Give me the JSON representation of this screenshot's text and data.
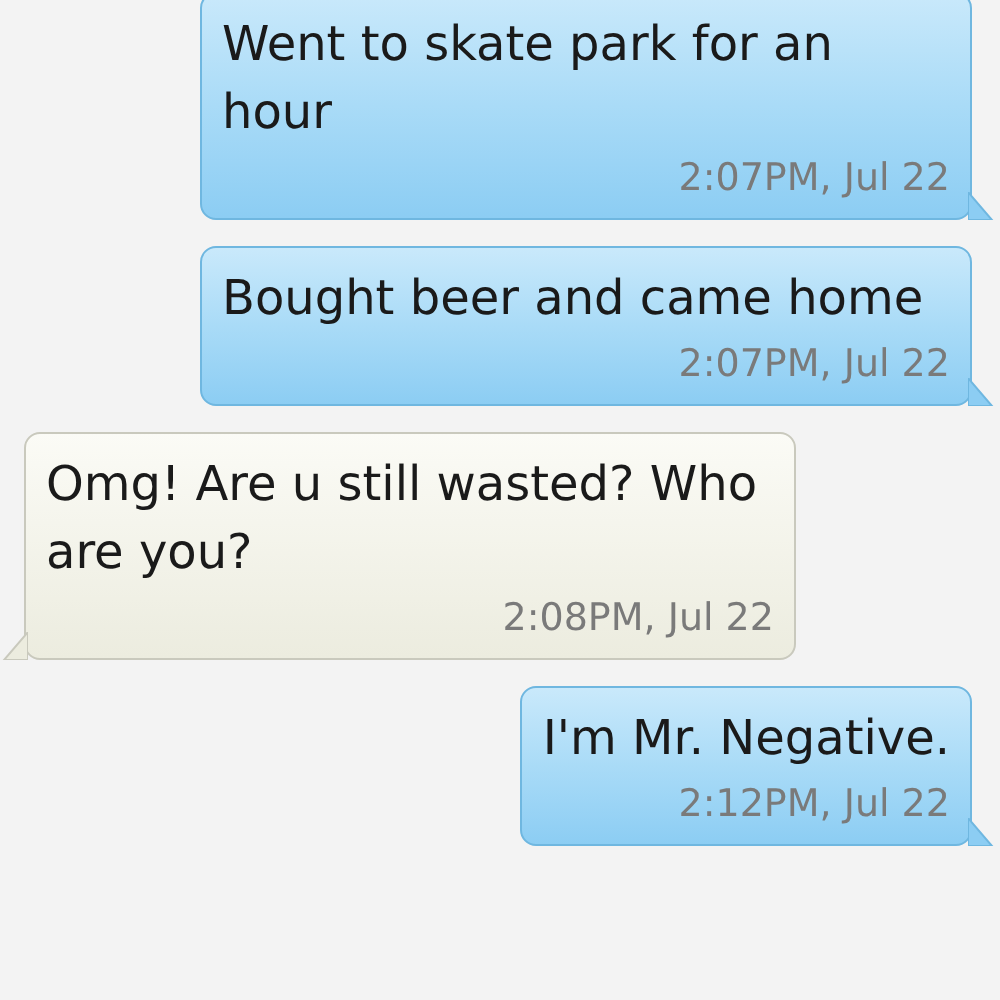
{
  "messages": [
    {
      "kind": "sent",
      "text": "Went to skate park for an hour",
      "time": "2:07PM, Jul 22"
    },
    {
      "kind": "sent",
      "text": "Bought beer and came home",
      "time": "2:07PM, Jul 22"
    },
    {
      "kind": "received",
      "text": "Omg! Are u still wasted? Who are you?",
      "time": "2:08PM, Jul 22"
    },
    {
      "kind": "sent",
      "text": "I'm Mr. Negative.",
      "time": "2:12PM, Jul 22"
    }
  ]
}
